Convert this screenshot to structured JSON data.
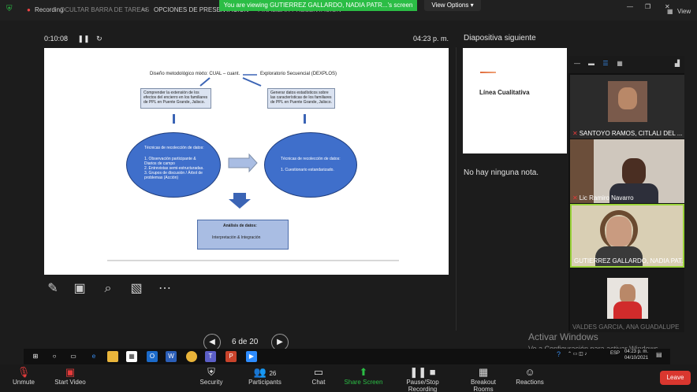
{
  "topbar": {
    "recording": "Recording",
    "hidden_menu": "OCULTAR BARRA DE TAREAS",
    "presentation_options": "OPCIONES DE PRESENTACIÓN",
    "finish_presentation": "FINALIZAR PRESENTACIÓN",
    "view": "View",
    "colors": {
      "banner": "#2bbd45",
      "leave": "#d9372f"
    }
  },
  "banner": {
    "text": "You are viewing GUTIERREZ GALLARDO, NADIA PATR...'s screen",
    "view_options": "View Options"
  },
  "presenter": {
    "timer": "0:10:08",
    "clock": "04:23 p. m.",
    "slide_counter": "6 de 20",
    "next_slide_label": "Diapositiva siguiente",
    "next_slide_title": "Línea Cualitativa",
    "notes": "No hay ninguna nota."
  },
  "slide": {
    "heading_left": "Diseño metodológico mixto: CUAL – cuant.",
    "heading_right": "Exploratorio Secuencial (DEXPLOS)",
    "box_left": "Comprender la extensión de los efectos del encierro en los familiares de PPL en Puente Grande, Jalisco.",
    "box_right": "Generar datos estadísticos sobre las características de los familiares de PPL en Puente Grande, Jalisco.",
    "oval_left_title": "Técnicas de recolección de datos:",
    "oval_left_items": "1. Observación participante & Diarios de campo\n2. Entrevistas semi-estructuradas.\n3. Grupos de discusión / Árbol de problemas (Acción)",
    "oval_right_title": "Técnicas de recolección de datos:",
    "oval_right_items": "1. Cuestionario estandarizado.",
    "analysis_title": "Análisis de datos:",
    "analysis_body": "Interpretación & Integración"
  },
  "participants_gallery": {
    "tiles": [
      {
        "name": "SANTOYO RAMOS, CITLALI DEL ...",
        "muted": true
      },
      {
        "name": "Lic Ramiro Navarro",
        "muted": true
      },
      {
        "name": "GUTIERREZ GALLARDO, NADIA PAT...",
        "muted": false
      },
      {
        "name": "VALDES GARCIA, ANA GUADALUPE",
        "muted": false
      }
    ]
  },
  "watermark": {
    "line1": "Activar Windows",
    "line2": "Ve a Configuración para activar Windows."
  },
  "taskbar": {
    "time": "04:23 p. m.",
    "date": "04/10/2021",
    "lang": "ESP"
  },
  "toolbar": {
    "unmute": "Unmute",
    "start_video": "Start Video",
    "security": "Security",
    "participants": "Participants",
    "participants_count": "26",
    "chat": "Chat",
    "share_screen": "Share Screen",
    "pause_stop_recording": "Pause/Stop Recording",
    "breakout_rooms": "Breakout Rooms",
    "reactions": "Reactions",
    "leave": "Leave"
  }
}
